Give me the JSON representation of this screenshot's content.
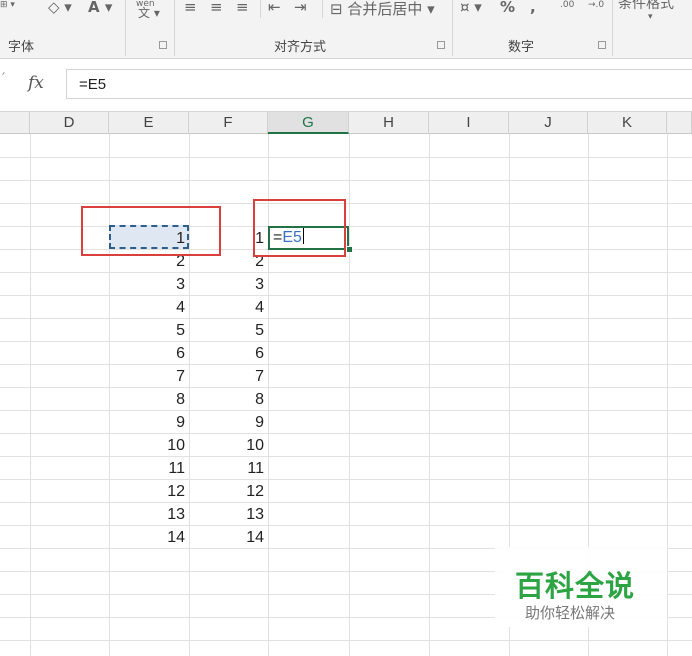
{
  "ribbon": {
    "groups": [
      {
        "label": "字体"
      },
      {
        "label": "对齐方式"
      },
      {
        "label": "数字"
      }
    ],
    "merge_center_label": "合并后居中",
    "percent_symbol": "%",
    "comma_symbol": ",",
    "font_color_letter": "A",
    "wen_small": "wén",
    "wen_char": "文",
    "conditional_format_label": "条件格式",
    "inc_decimal": ".00",
    "dec_decimal": "→.0"
  },
  "formula_bar": {
    "fx": "fx",
    "content": "=E5"
  },
  "columns": [
    "D",
    "E",
    "F",
    "G",
    "H",
    "I",
    "J",
    "K"
  ],
  "selected_column": "G",
  "sheet": {
    "column_e": [
      "1",
      "2",
      "3",
      "4",
      "5",
      "6",
      "7",
      "8",
      "9",
      "10",
      "11",
      "12",
      "13",
      "14"
    ],
    "column_f": [
      "1",
      "2",
      "3",
      "4",
      "5",
      "6",
      "7",
      "8",
      "9",
      "10",
      "11",
      "12",
      "13",
      "14"
    ],
    "editing_cell": {
      "prefix": "=",
      "reference": "E5"
    }
  },
  "watermark": {
    "title": "百科全说",
    "subtitle": "助你轻松解决"
  },
  "colors": {
    "accent": "#217346",
    "highlight_box": "#d9403c",
    "watermark_green": "#2da443",
    "reference_blue": "#3a6fc4"
  }
}
